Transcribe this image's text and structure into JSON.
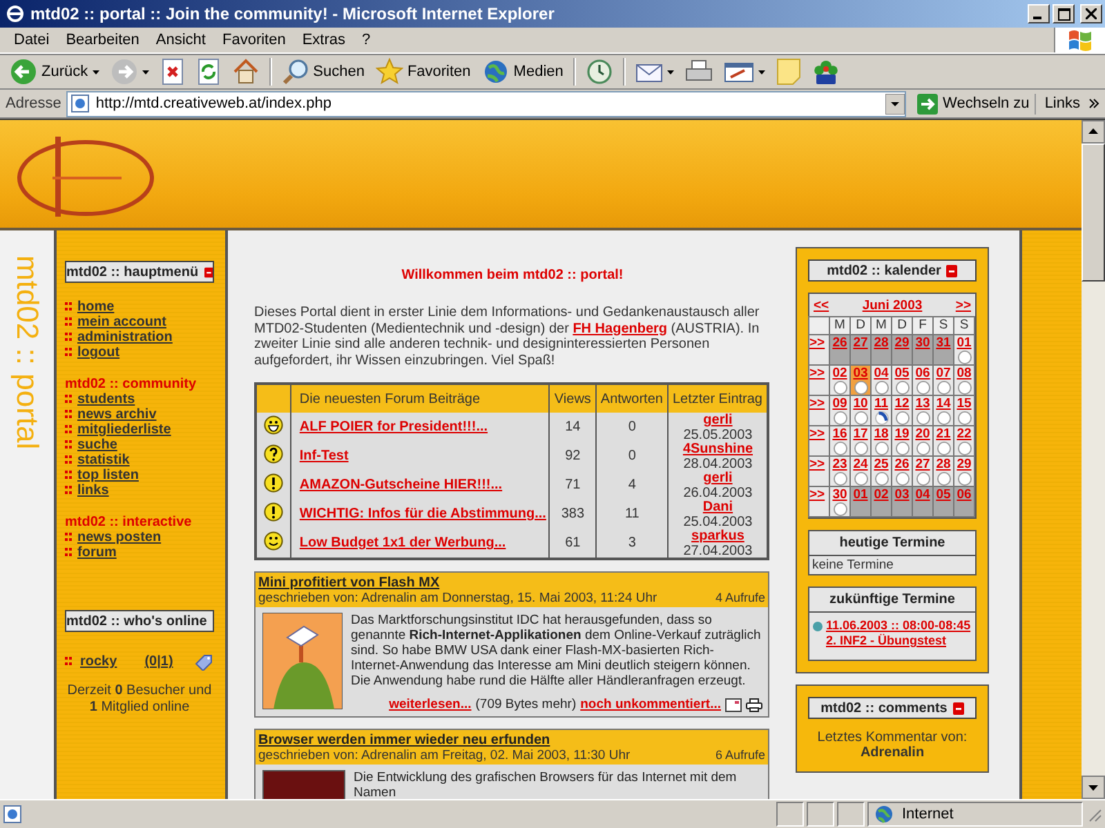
{
  "window": {
    "title": "mtd02 :: portal :: Join the community! - Microsoft Internet Explorer"
  },
  "menu": [
    "Datei",
    "Bearbeiten",
    "Ansicht",
    "Favoriten",
    "Extras",
    "?"
  ],
  "toolbar": [
    {
      "kind": "back",
      "label": "Zurück",
      "dropdown": true
    },
    {
      "kind": "forward",
      "dropdown": true
    },
    {
      "kind": "stop",
      "dropdown": false
    },
    {
      "kind": "refresh",
      "dropdown": false
    },
    {
      "kind": "home",
      "dropdown": false
    },
    {
      "kind": "search",
      "label": "Suchen",
      "dropdown": false
    },
    {
      "kind": "favorites",
      "label": "Favoriten",
      "dropdown": false
    },
    {
      "kind": "media",
      "label": "Medien",
      "dropdown": false
    },
    {
      "kind": "history",
      "dropdown": false
    },
    {
      "kind": "mail",
      "dropdown": true
    },
    {
      "kind": "print",
      "dropdown": false
    },
    {
      "kind": "edit",
      "dropdown": true
    },
    {
      "kind": "note",
      "dropdown": false
    },
    {
      "kind": "messenger",
      "dropdown": false
    }
  ],
  "address": {
    "label": "Adresse",
    "value": "http://mtd.creativeweb.at/index.php",
    "go": "Wechseln zu",
    "links": "Links"
  },
  "side_title": "mtd02 :: portal",
  "main_menu": {
    "title": "mtd02 :: hauptmenü",
    "groups": [
      {
        "items": [
          "home",
          "mein account",
          "administration",
          "logout"
        ]
      },
      {
        "heading": "mtd02 :: community",
        "items": [
          "students",
          "news archiv",
          "mitgliederliste",
          "suche",
          "statistik",
          "top listen",
          "links"
        ]
      },
      {
        "heading": "mtd02 :: interactive",
        "items": [
          "news posten",
          "forum"
        ]
      }
    ]
  },
  "whos_online": {
    "title": "mtd02 :: who's online",
    "users": [
      {
        "name": "rocky",
        "counts": "(0|1)"
      }
    ],
    "summary": "Derzeit **0** Besucher und **1** Mitglied online"
  },
  "welcome": "Willkommen beim mtd02 :: portal!",
  "intro": {
    "before": "Dieses Portal dient in erster Linie dem Informations- und Gedankenaustausch aller MTD02-Studenten (Medientechnik und -design) der ",
    "link": "FH Hagenberg",
    "after": " (AUSTRIA). In zweiter Linie sind alle anderen technik- und designinteressierten Personen aufgefordert, ihr Wissen einzubringen. Viel Spaß!"
  },
  "forum": {
    "columns": [
      "Die neuesten Forum Beiträge",
      "Views",
      "Antworten",
      "Letzter Eintrag"
    ],
    "rows": [
      {
        "kind": "grin",
        "title": "ALF POIER for President!!!...",
        "views": "14",
        "replies": "0",
        "user": "gerli",
        "date": "25.05.2003"
      },
      {
        "kind": "question",
        "title": "Inf-Test",
        "views": "92",
        "replies": "0",
        "user": "4Sunshine",
        "date": "28.04.2003"
      },
      {
        "kind": "exclaim",
        "title": "AMAZON-Gutscheine HIER!!!...",
        "views": "71",
        "replies": "4",
        "user": "gerli",
        "date": "26.04.2003"
      },
      {
        "kind": "exclaim",
        "title": "WICHTIG: Infos für die Abstimmung...",
        "views": "383",
        "replies": "11",
        "user": "Dani",
        "date": "25.04.2003"
      },
      {
        "kind": "smile",
        "title": "Low Budget 1x1 der Werbung...",
        "views": "61",
        "replies": "3",
        "user": "sparkus",
        "date": "27.04.2003"
      }
    ]
  },
  "news": [
    {
      "title": "Mini profitiert von Flash MX",
      "byline": "geschrieben von: Adrenalin am Donnerstag, 15. Mai 2003, 11:24 Uhr",
      "views": "4 Aufrufe",
      "kind": "illustration",
      "body": "Das Marktforschungsinstitut IDC hat herausgefunden, dass so genannte **Rich-Internet-Applikationen** dem Online-Verkauf zuträglich sind. So habe BMW USA dank einer Flash-MX-basierten Rich-Internet-Anwendung das Interesse am Mini deutlich steigern können. Die Anwendung habe rund die Hälfte aller Händleranfragen erzeugt.",
      "more": "weiterlesen...",
      "bytes": "(709 Bytes mehr)",
      "comments": "noch unkommentiert..."
    },
    {
      "title": "Browser werden immer wieder neu erfunden",
      "byline": "geschrieben von: Adrenalin am Freitag, 02. Mai 2003, 11:30 Uhr",
      "views": "6 Aufrufe",
      "kind": "photo",
      "body": "Die Entwicklung des grafischen Browsers für das Internet mit dem Namen"
    }
  ],
  "calendar": {
    "title": "mtd02 :: kalender",
    "prev": "<<",
    "month": "Juni 2003",
    "next": ">>",
    "weekdays": [
      "M",
      "D",
      "M",
      "D",
      "F",
      "S",
      "S"
    ],
    "weeks": [
      {
        "link": ">>",
        "days": [
          {
            "label": "26",
            "in_month": false,
            "selected": false,
            "event": false
          },
          {
            "label": "27",
            "in_month": false,
            "selected": false,
            "event": false
          },
          {
            "label": "28",
            "in_month": false,
            "selected": false,
            "event": false
          },
          {
            "label": "29",
            "in_month": false,
            "selected": false,
            "event": false
          },
          {
            "label": "30",
            "in_month": false,
            "selected": false,
            "event": false
          },
          {
            "label": "31",
            "in_month": false,
            "selected": false,
            "event": false
          },
          {
            "label": "01",
            "in_month": true,
            "selected": false,
            "event": false
          }
        ]
      },
      {
        "link": ">>",
        "days": [
          {
            "label": "02",
            "in_month": true,
            "selected": false,
            "event": false
          },
          {
            "label": "03",
            "in_month": true,
            "selected": true,
            "event": false
          },
          {
            "label": "04",
            "in_month": true,
            "selected": false,
            "event": false
          },
          {
            "label": "05",
            "in_month": true,
            "selected": false,
            "event": false
          },
          {
            "label": "06",
            "in_month": true,
            "selected": false,
            "event": false
          },
          {
            "label": "07",
            "in_month": true,
            "selected": false,
            "event": false
          },
          {
            "label": "08",
            "in_month": true,
            "selected": false,
            "event": false
          }
        ]
      },
      {
        "link": ">>",
        "days": [
          {
            "label": "09",
            "in_month": true,
            "selected": false,
            "event": false
          },
          {
            "label": "10",
            "in_month": true,
            "selected": false,
            "event": false
          },
          {
            "label": "11",
            "in_month": true,
            "selected": false,
            "event": true
          },
          {
            "label": "12",
            "in_month": true,
            "selected": false,
            "event": false
          },
          {
            "label": "13",
            "in_month": true,
            "selected": false,
            "event": false
          },
          {
            "label": "14",
            "in_month": true,
            "selected": false,
            "event": false
          },
          {
            "label": "15",
            "in_month": true,
            "selected": false,
            "event": false
          }
        ]
      },
      {
        "link": ">>",
        "days": [
          {
            "label": "16",
            "in_month": true,
            "selected": false,
            "event": false
          },
          {
            "label": "17",
            "in_month": true,
            "selected": false,
            "event": false
          },
          {
            "label": "18",
            "in_month": true,
            "selected": false,
            "event": false
          },
          {
            "label": "19",
            "in_month": true,
            "selected": false,
            "event": false
          },
          {
            "label": "20",
            "in_month": true,
            "selected": false,
            "event": false
          },
          {
            "label": "21",
            "in_month": true,
            "selected": false,
            "event": false
          },
          {
            "label": "22",
            "in_month": true,
            "selected": false,
            "event": false
          }
        ]
      },
      {
        "link": ">>",
        "days": [
          {
            "label": "23",
            "in_month": true,
            "selected": false,
            "event": false
          },
          {
            "label": "24",
            "in_month": true,
            "selected": false,
            "event": false
          },
          {
            "label": "25",
            "in_month": true,
            "selected": false,
            "event": false
          },
          {
            "label": "26",
            "in_month": true,
            "selected": false,
            "event": false
          },
          {
            "label": "27",
            "in_month": true,
            "selected": false,
            "event": false
          },
          {
            "label": "28",
            "in_month": true,
            "selected": false,
            "event": false
          },
          {
            "label": "29",
            "in_month": true,
            "selected": false,
            "event": false
          }
        ]
      },
      {
        "link": ">>",
        "days": [
          {
            "label": "30",
            "in_month": true,
            "selected": false,
            "event": false
          },
          {
            "label": "01",
            "in_month": false,
            "selected": false,
            "event": false
          },
          {
            "label": "02",
            "in_month": false,
            "selected": false,
            "event": false
          },
          {
            "label": "03",
            "in_month": false,
            "selected": false,
            "event": false
          },
          {
            "label": "04",
            "in_month": false,
            "selected": false,
            "event": false
          },
          {
            "label": "05",
            "in_month": false,
            "selected": false,
            "event": false
          },
          {
            "label": "06",
            "in_month": false,
            "selected": false,
            "event": false
          }
        ]
      }
    ]
  },
  "today_events": {
    "title": "heutige Termine",
    "text": "keine Termine"
  },
  "future_events": {
    "title": "zukünftige Termine",
    "items": [
      {
        "lines": [
          "11.06.2003 :: 08:00-08:45",
          "2. INF2 - Übungstest"
        ]
      }
    ]
  },
  "comments": {
    "title": "mtd02 :: comments",
    "label": "Letztes Kommentar von:",
    "user": "Adrenalin"
  },
  "status_bar": {
    "zone": "Internet"
  }
}
